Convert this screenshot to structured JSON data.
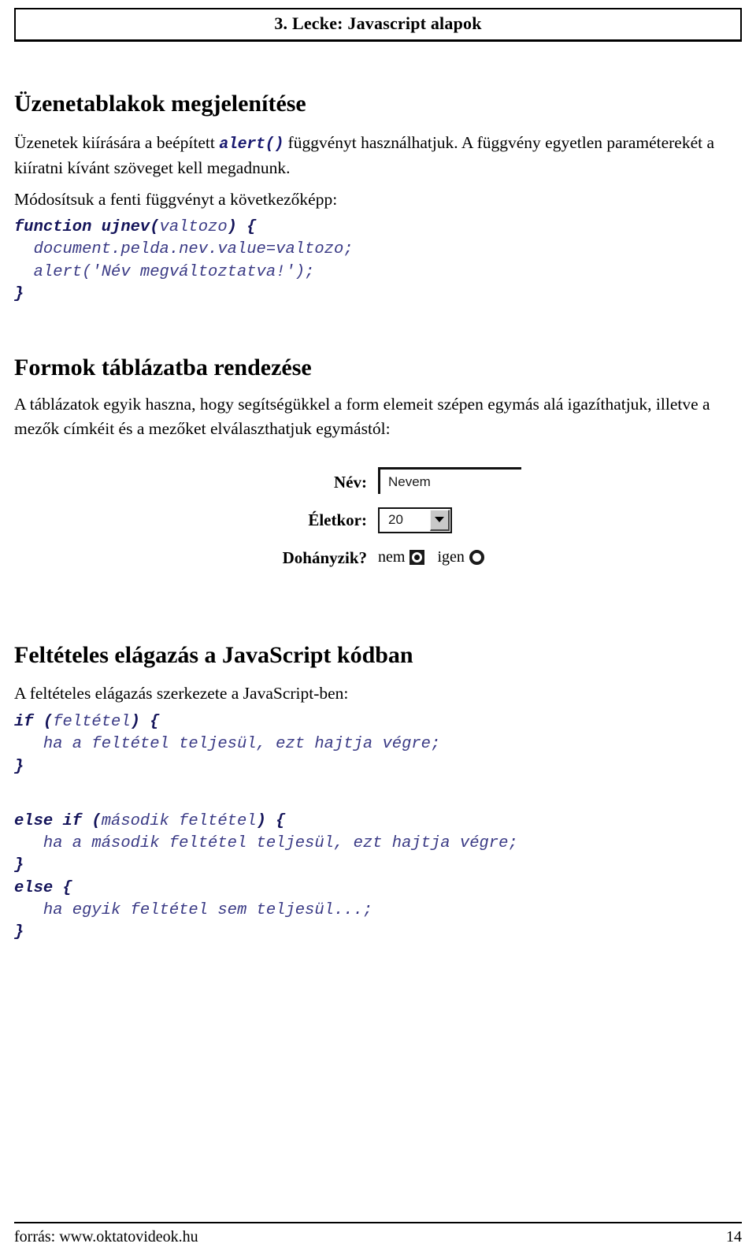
{
  "header": {
    "title": "3. Lecke: Javascript alapok"
  },
  "sections": {
    "messages": {
      "heading": "Üzenetablakok megjelenítése",
      "intro_before": "Üzenetek kiírására a beépített ",
      "intro_code": "alert()",
      "intro_after": " függvényt használhatjuk. A függvény egyetlen paraméterekét a kiíratni kívánt szöveget kell megadnunk.",
      "modify_text": "Módosítsuk a fenti függvényt a következőképp:",
      "code": {
        "line1_bold": "function ujnev(",
        "line1_dim": "valtozo",
        "line1_bold2": ") {",
        "line2": "  document.pelda.nev.value=valtozo;",
        "line3": "  alert('Név megváltoztatva!');",
        "line4": "}"
      }
    },
    "forms": {
      "heading": "Formok táblázatba rendezése",
      "paragraph": "A táblázatok egyik haszna, hogy segítségükkel a form elemeit szépen egymás alá igazíthatjuk, illetve a mezők címkéit és a mezőket elválaszthatjuk egymástól:",
      "demo": {
        "name_label": "Név:",
        "name_value": "Nevem",
        "age_label": "Életkor:",
        "age_value": "20",
        "age_options": [
          "20"
        ],
        "smoke_label": "Dohányzik?",
        "radio_no_label": "nem",
        "radio_no_checked": true,
        "radio_yes_label": "igen",
        "radio_yes_checked": false
      }
    },
    "conditional": {
      "heading": "Feltételes elágazás a JavaScript kódban",
      "paragraph": "A feltételes elágazás szerkezete a JavaScript-ben:",
      "code": {
        "l1_kw": "if (",
        "l1_dim": "feltétel",
        "l1_kw2": ") {",
        "l2": "   ha a feltétel teljesül, ezt hajtja végre;",
        "l3": "}",
        "l4_kw": "else if (",
        "l4_dim": "második feltétel",
        "l4_kw2": ") {",
        "l5": "   ha a második feltétel teljesül, ezt hajtja végre;",
        "l6": "}",
        "l7_kw": "else {",
        "l8": "   ha egyik feltétel sem teljesül...;",
        "l9": "}"
      }
    }
  },
  "footer": {
    "source": "forrás:  www.oktatovideok.hu",
    "page_number": "14"
  },
  "colors": {
    "code_navy": "#262673",
    "code_keyword": "#14145a",
    "inline_code": "#191970",
    "text": "#000000",
    "select_button": "#c8c8c8"
  }
}
